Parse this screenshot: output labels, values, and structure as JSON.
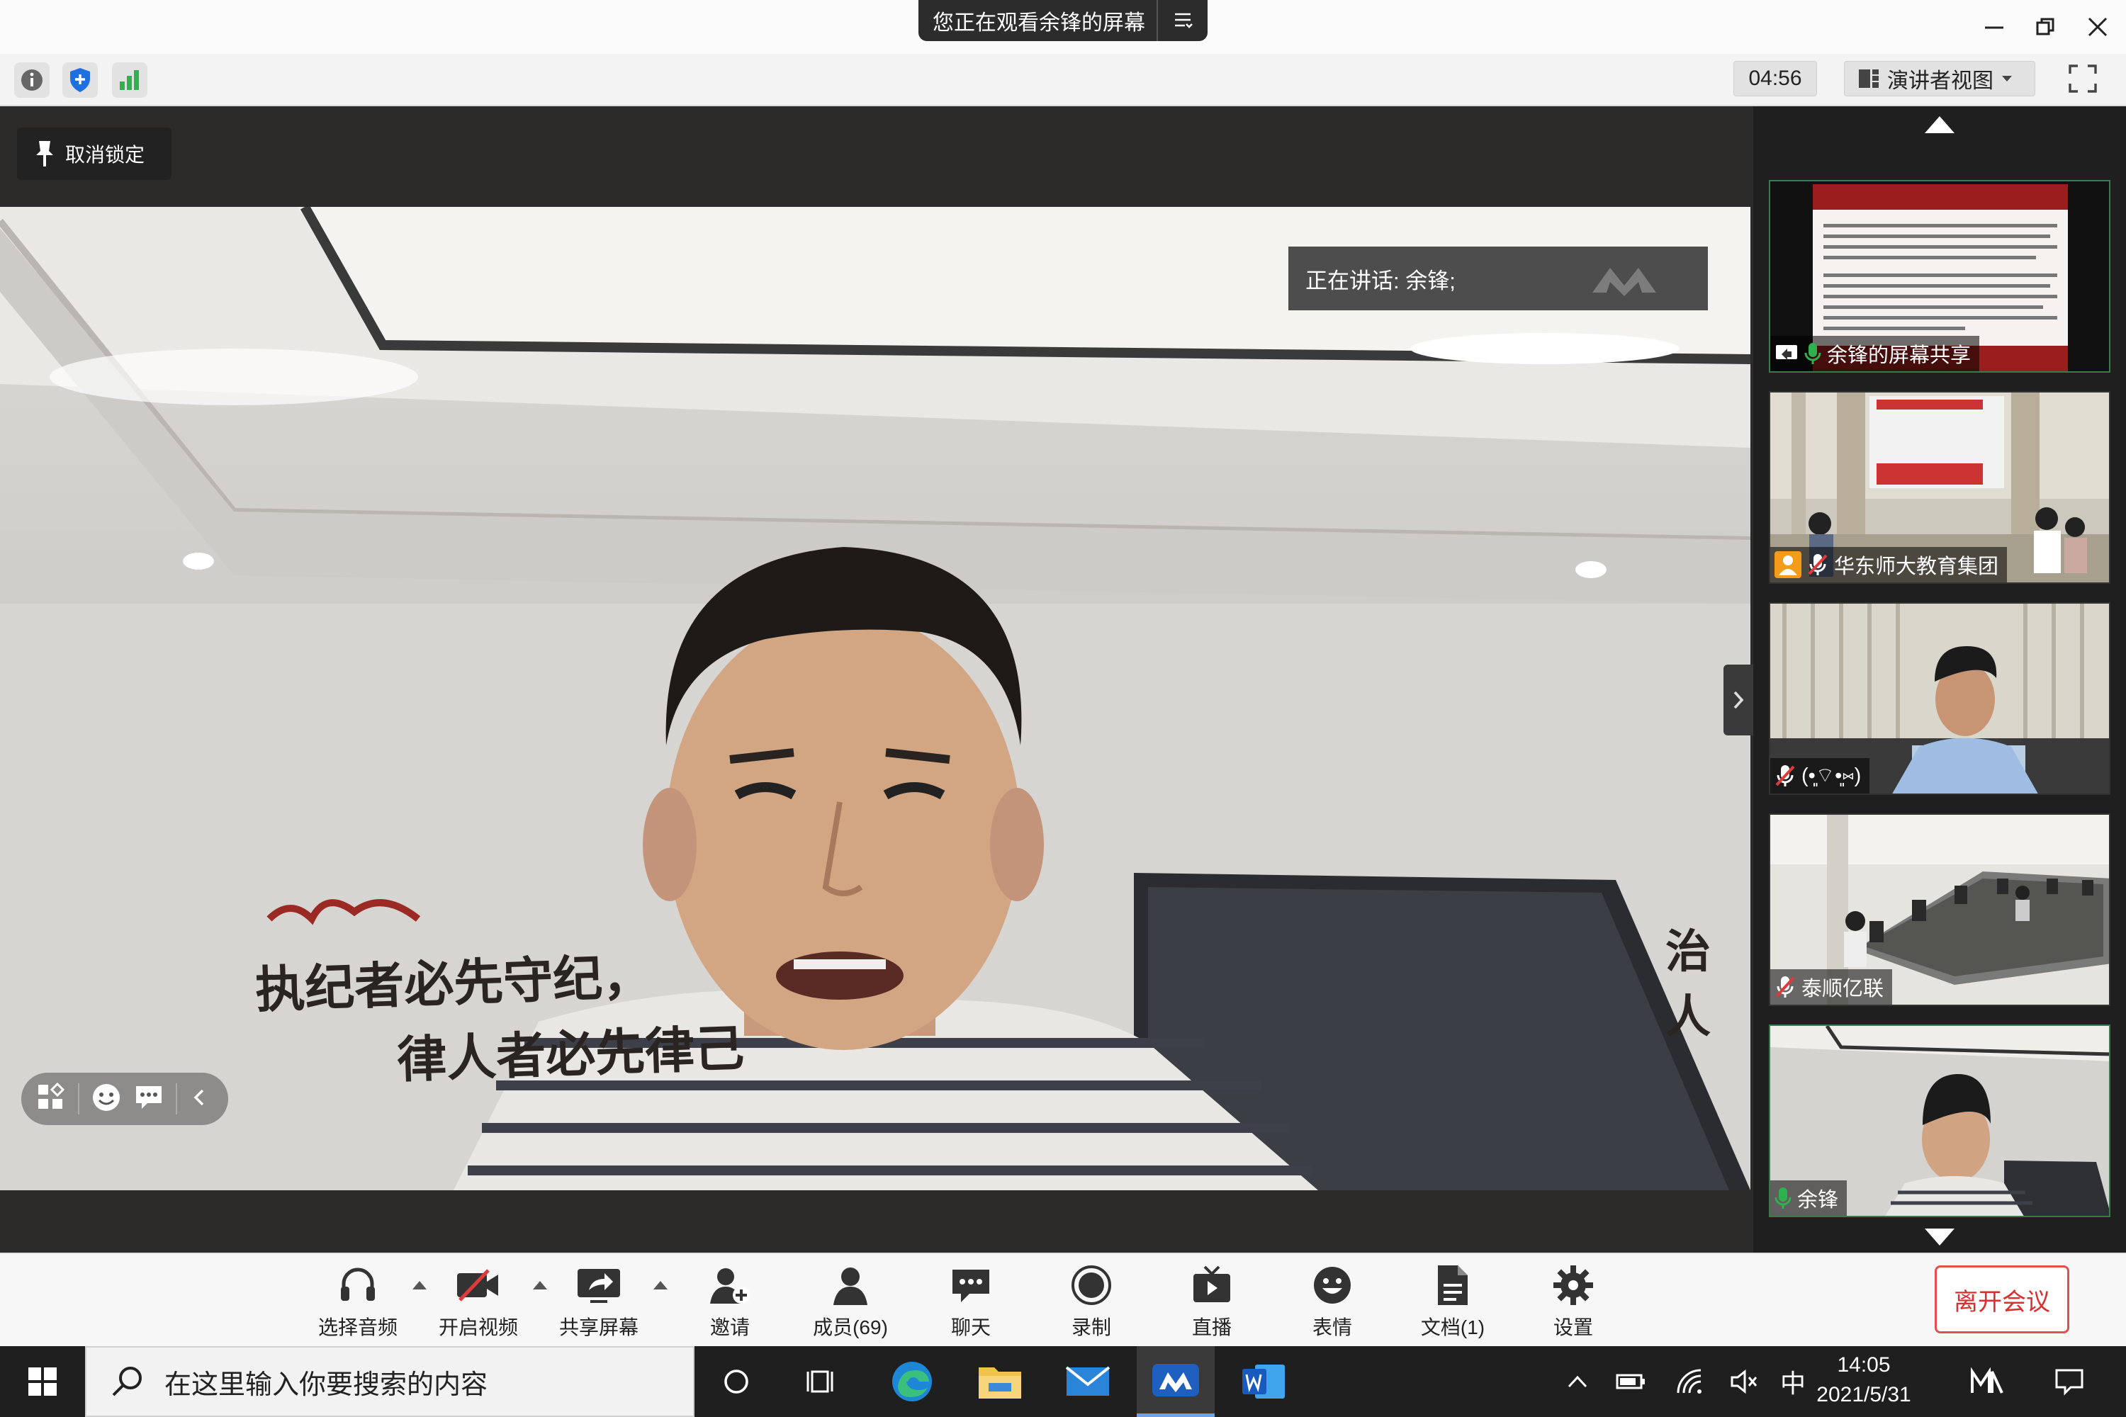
{
  "title_bar": {
    "share_banner": "您正在观看余锋的屏幕"
  },
  "toolbar": {
    "icons": [
      "info-icon",
      "shield-icon",
      "signal-icon"
    ],
    "timer": "04:56",
    "view_selector": "演讲者视图"
  },
  "main_video": {
    "unlock_button": "取消锁定",
    "speaking_label": "正在讲话: 余锋;",
    "wall_text_line1": "执纪者必先守纪，",
    "wall_text_line2": "律人者必先律己",
    "wall_text_right": "治人"
  },
  "sidebar": {
    "tiles": [
      {
        "label": "余锋的屏幕共享",
        "mic": "on",
        "kind": "screen-share"
      },
      {
        "label": "华东师大教育集团",
        "mic": "muted",
        "kind": "room"
      },
      {
        "label": "(•͈⌔•͈⑅)",
        "mic": "muted",
        "kind": "person"
      },
      {
        "label": "泰顺亿联",
        "mic": "muted",
        "kind": "room"
      },
      {
        "label": "余锋",
        "mic": "on",
        "kind": "person"
      }
    ]
  },
  "bottom_bar": {
    "buttons": [
      {
        "label": "选择音频",
        "icon": "headset-icon"
      },
      {
        "label": "开启视频",
        "icon": "camera-off-icon"
      },
      {
        "label": "共享屏幕",
        "icon": "share-screen-icon"
      },
      {
        "label": "邀请",
        "icon": "invite-icon"
      },
      {
        "label": "成员(69)",
        "icon": "members-icon"
      },
      {
        "label": "聊天",
        "icon": "chat-icon"
      },
      {
        "label": "录制",
        "icon": "record-icon"
      },
      {
        "label": "直播",
        "icon": "live-icon"
      },
      {
        "label": "表情",
        "icon": "emoji-icon"
      },
      {
        "label": "文档(1)",
        "icon": "document-icon"
      },
      {
        "label": "设置",
        "icon": "settings-icon"
      }
    ],
    "leave_button": "离开会议"
  },
  "taskbar": {
    "search_placeholder": "在这里输入你要搜索的内容",
    "ime": "中",
    "time": "14:05",
    "date": "2021/5/31"
  },
  "colors": {
    "accent_green": "#2fb14d",
    "leave_red": "#e34f4f",
    "mute_red": "#e03b3b"
  }
}
